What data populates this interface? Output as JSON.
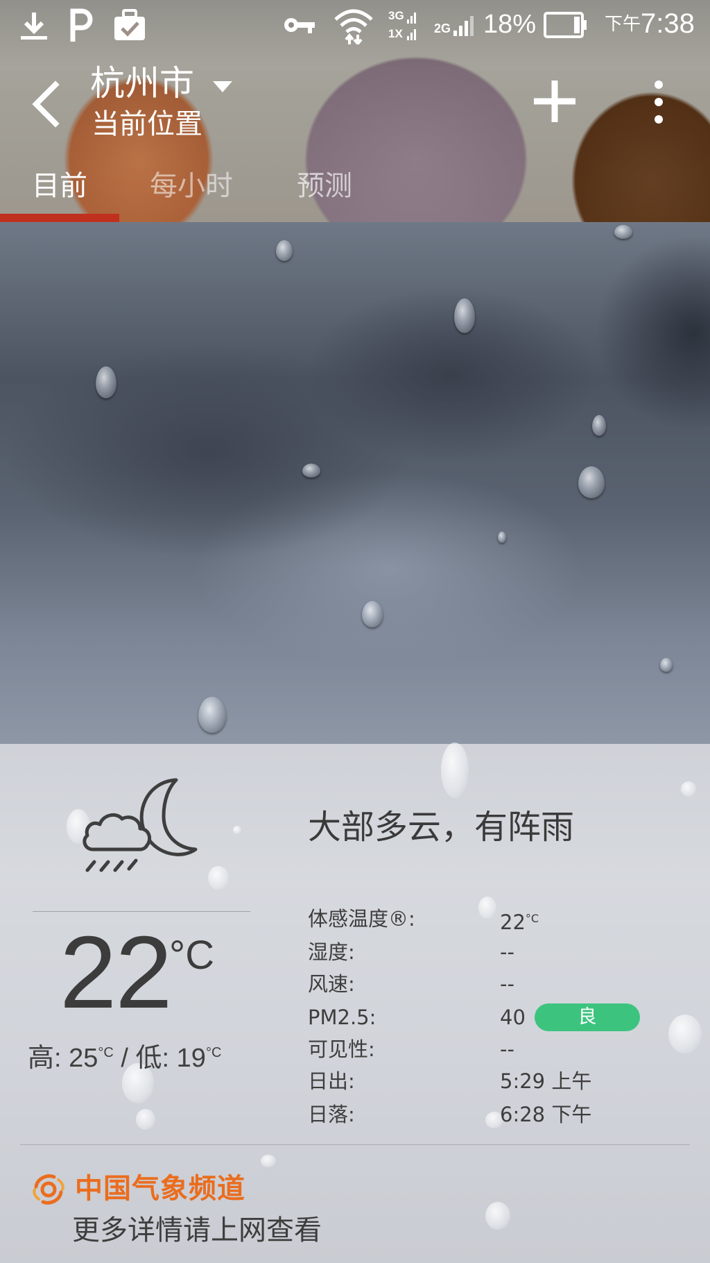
{
  "status_bar": {
    "battery_percent": "18%",
    "battery_level": 0.18,
    "time_ampm": "下午",
    "time_hm": "7:38",
    "network_1": "3G",
    "network_2": "1X",
    "network_3": "2G",
    "icons": [
      "download-icon",
      "p-icon",
      "briefcase-check-icon",
      "vpn-key-icon",
      "wifi-icon",
      "signal-icon",
      "battery-icon"
    ]
  },
  "app_bar": {
    "city": "杭州市",
    "location_label": "当前位置"
  },
  "tabs": [
    {
      "label": "目前",
      "active": true
    },
    {
      "label": "每小时",
      "active": false
    },
    {
      "label": "预测",
      "active": false
    }
  ],
  "current": {
    "condition": "大部多云，有阵雨",
    "temperature": "22",
    "unit": "°C",
    "high_label": "高: ",
    "high": "25",
    "low_label": "低: ",
    "low": "19",
    "separator": "/",
    "small_unit": "°C"
  },
  "details": [
    {
      "label": "体感温度®:",
      "value": "22",
      "unit": "°C"
    },
    {
      "label": "湿度:",
      "value": "--"
    },
    {
      "label": "风速:",
      "value": "--"
    },
    {
      "label": "PM2.5:",
      "value": "40",
      "badge": "良"
    },
    {
      "label": "可见性:",
      "value": "--"
    },
    {
      "label": "日出:",
      "value": "5:29 上午"
    },
    {
      "label": "日落:",
      "value": "6:28 下午"
    }
  ],
  "footer": {
    "brand": "中国气象频道",
    "more_link": "更多详情请上网查看"
  },
  "colors": {
    "tab_indicator": "#c0301f",
    "aqi_good": "#3cc47f",
    "brand_orange": "#ea6d1f"
  }
}
